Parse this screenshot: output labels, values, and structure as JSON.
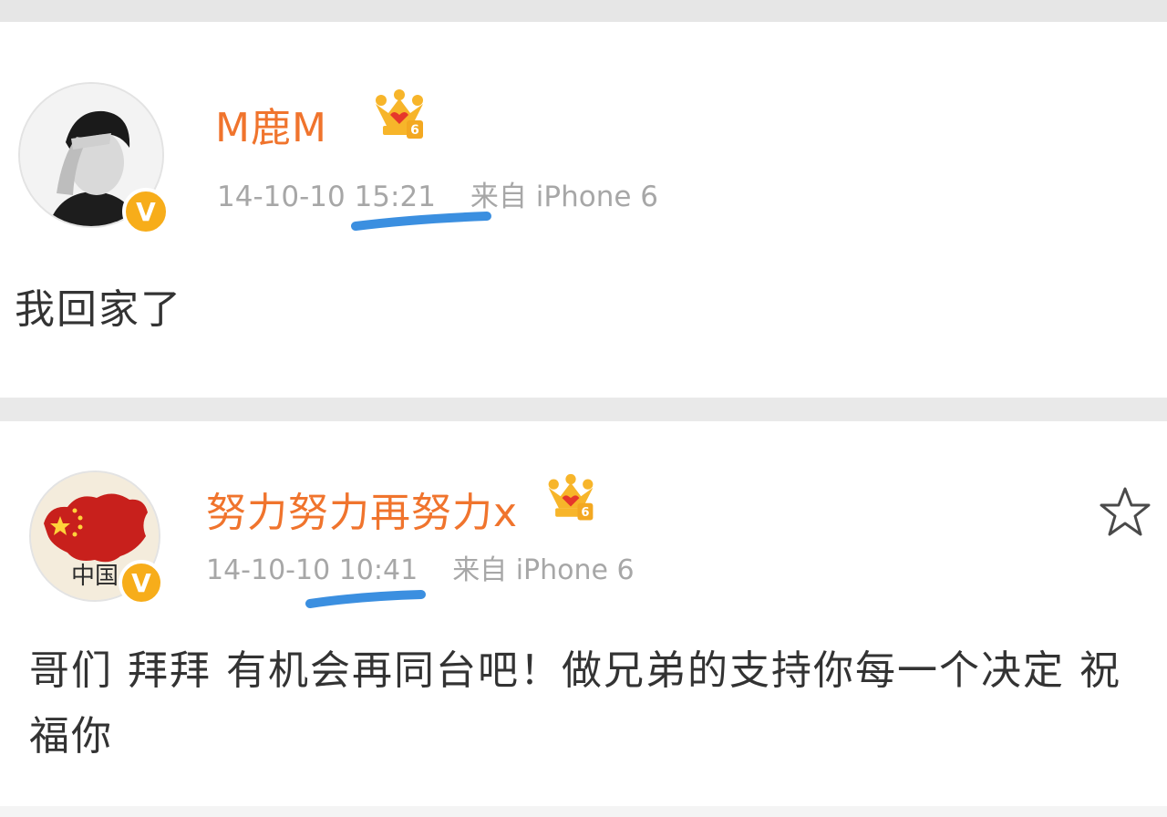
{
  "posts": [
    {
      "username": "M鹿M",
      "date": "14-10-10",
      "time": "15:21",
      "source": "来自 iPhone 6",
      "content": "我回家了",
      "verified_badge": "V",
      "member_level": "6",
      "icons": [
        "avatar-photo",
        "verified-v-icon",
        "vip-crown-icon"
      ]
    },
    {
      "username": "努力努力再努力x",
      "date": "14-10-10",
      "time": "10:41",
      "source": "来自 iPhone 6",
      "content": "哥们 拜拜 有机会再同台吧！做兄弟的支持你每一个决定 祝福你",
      "verified_badge": "V",
      "member_level": "6",
      "avatar_text": "中国",
      "icons": [
        "avatar-china-map",
        "verified-v-icon",
        "vip-crown-icon",
        "star-outline-icon"
      ]
    }
  ],
  "colors": {
    "username": "#f0742d",
    "meta": "#a7a7a7",
    "verified": "#f7ad1a",
    "highlight_mark": "#3b8fe0",
    "content": "#333333"
  }
}
